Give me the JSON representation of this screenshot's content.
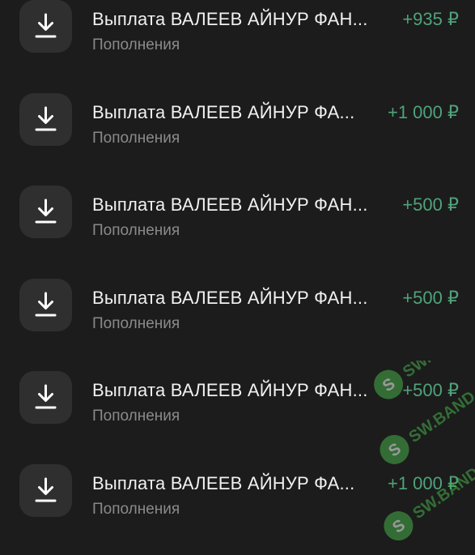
{
  "transactions": [
    {
      "title": "Выплата ВАЛЕЕВ АЙНУР ФАН...",
      "category": "Пополнения",
      "amount": "+935 ₽",
      "icon": "download-icon"
    },
    {
      "title": "Выплата ВАЛЕЕВ АЙНУР ФА...",
      "category": "Пополнения",
      "amount": "+1 000 ₽",
      "icon": "download-icon"
    },
    {
      "title": "Выплата ВАЛЕЕВ АЙНУР ФАН...",
      "category": "Пополнения",
      "amount": "+500 ₽",
      "icon": "download-icon"
    },
    {
      "title": "Выплата ВАЛЕЕВ АЙНУР ФАН...",
      "category": "Пополнения",
      "amount": "+500 ₽",
      "icon": "download-icon"
    },
    {
      "title": "Выплата ВАЛЕЕВ АЙНУР ФАН...",
      "category": "Пополнения",
      "amount": "+500 ₽",
      "icon": "download-icon"
    },
    {
      "title": "Выплата ВАЛЕЕВ АЙНУР ФА...",
      "category": "Пополнения",
      "amount": "+1 000 ₽",
      "icon": "download-icon"
    }
  ],
  "watermark": {
    "text": "SW.BAND"
  },
  "colors": {
    "background": "#1c1c1c",
    "icon_tile": "#2f2f2f",
    "income": "#4fa37a",
    "secondary_text": "#8a8a8a",
    "watermark": "#46b04a"
  }
}
